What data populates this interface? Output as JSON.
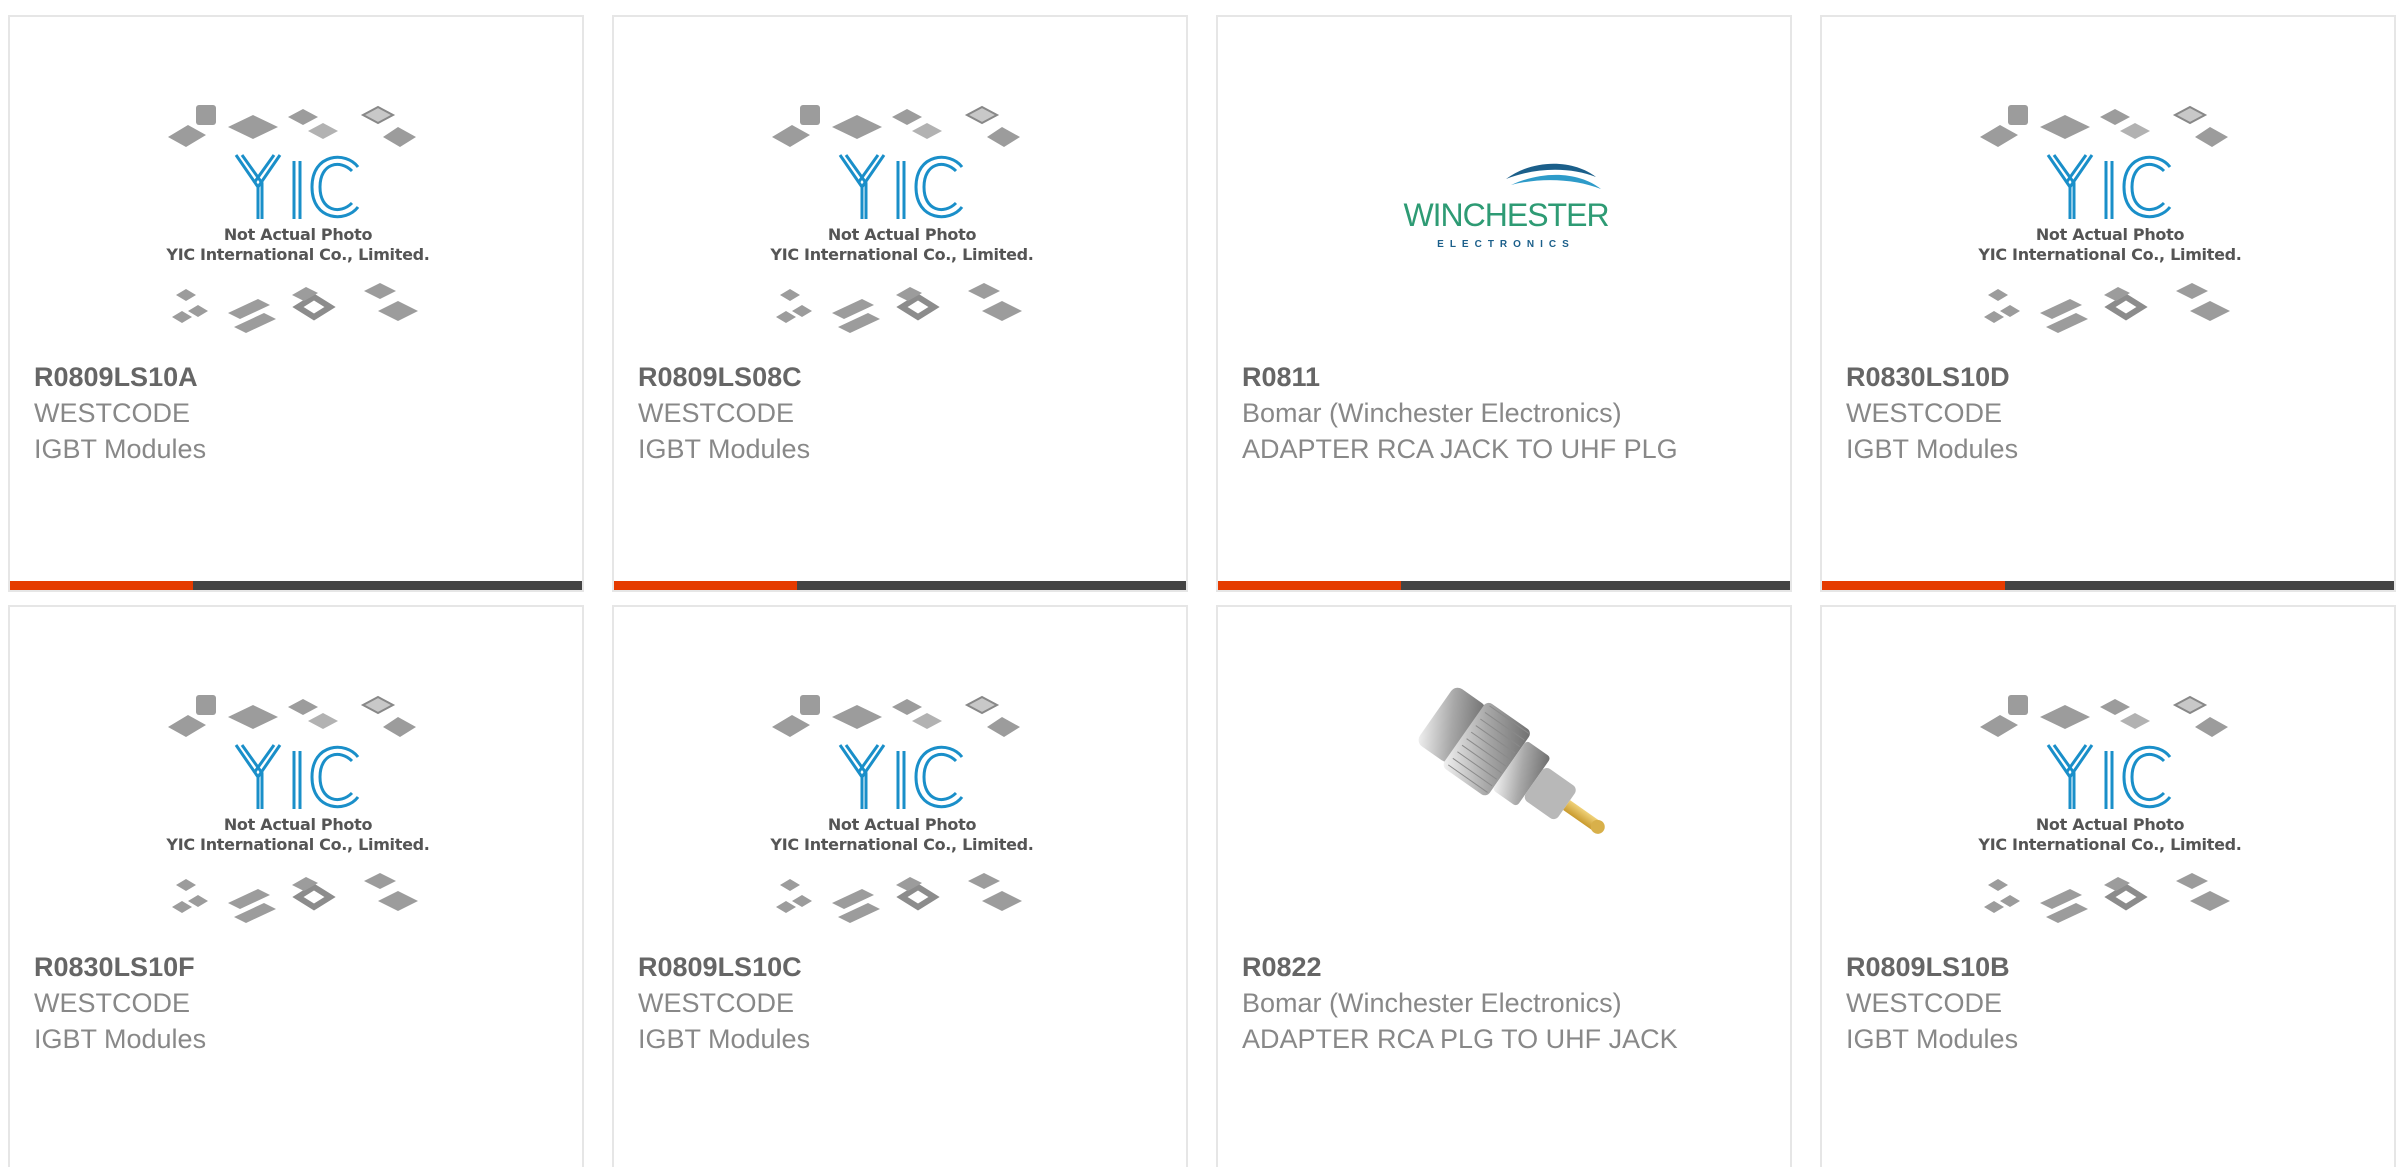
{
  "products": [
    {
      "part": "R0809LS10A",
      "maker": "WESTCODE",
      "desc": "IGBT Modules",
      "image": "yic-placeholder"
    },
    {
      "part": "R0809LS08C",
      "maker": "WESTCODE",
      "desc": "IGBT Modules",
      "image": "yic-placeholder"
    },
    {
      "part": "R0811",
      "maker": "Bomar (Winchester Electronics)",
      "desc": "ADAPTER RCA JACK TO UHF PLG",
      "image": "winchester-logo"
    },
    {
      "part": "R0830LS10D",
      "maker": "WESTCODE",
      "desc": "IGBT Modules",
      "image": "yic-placeholder"
    },
    {
      "part": "R0830LS10F",
      "maker": "WESTCODE",
      "desc": "IGBT Modules",
      "image": "yic-placeholder"
    },
    {
      "part": "R0809LS10C",
      "maker": "WESTCODE",
      "desc": "IGBT Modules",
      "image": "yic-placeholder"
    },
    {
      "part": "R0822",
      "maker": "Bomar (Winchester Electronics)",
      "desc": "ADAPTER RCA PLG TO UHF JACK",
      "image": "rca-adapter-photo"
    },
    {
      "part": "R0809LS10B",
      "maker": "WESTCODE",
      "desc": "IGBT Modules",
      "image": "yic-placeholder"
    }
  ],
  "placeholder": {
    "line1": "Not Actual Photo",
    "line2": "YIC International Co., Limited."
  },
  "winchester_logo": {
    "name": "WINCHESTER",
    "sub": "ELECTRONICS"
  },
  "colors": {
    "accent": "#e53b00",
    "bar": "#444444",
    "part_text": "#666666",
    "meta_text": "#888888",
    "yic_blue": "#1a8fc9",
    "winchester_green": "#2e9b74"
  }
}
